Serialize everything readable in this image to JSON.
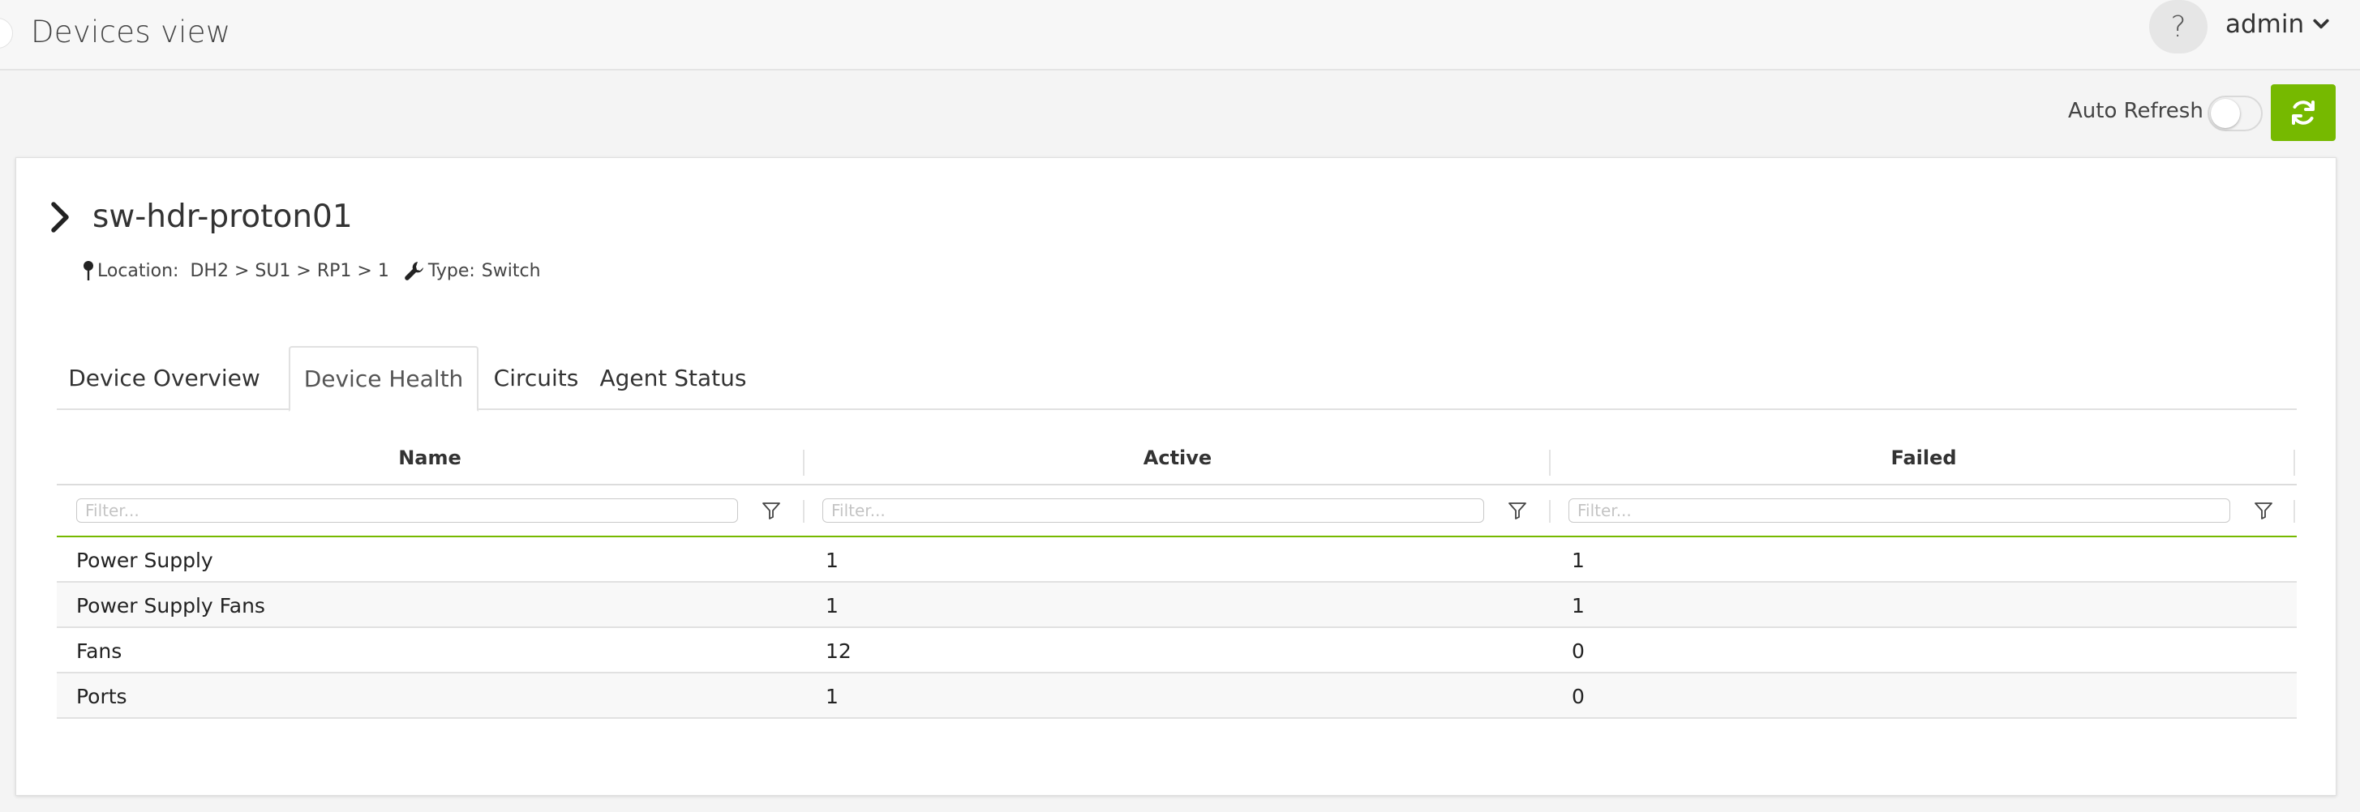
{
  "header": {
    "title": "Devices view",
    "help_label": "?",
    "user": "admin"
  },
  "toolbar": {
    "auto_refresh_label": "Auto Refresh",
    "auto_refresh_on": false
  },
  "device": {
    "name": "sw-hdr-proton01",
    "location_label": "Location:",
    "location_value": "DH2 > SU1 > RP1 > 1",
    "type_label": "Type:",
    "type_value": "Switch"
  },
  "tabs": [
    {
      "label": "Device Overview",
      "active": false
    },
    {
      "label": "Device Health",
      "active": true
    },
    {
      "label": "Circuits",
      "active": false
    },
    {
      "label": "Agent Status",
      "active": false
    }
  ],
  "table": {
    "columns": [
      "Name",
      "Active",
      "Failed"
    ],
    "filter_placeholder": "Filter...",
    "rows": [
      [
        "Power Supply",
        "1",
        "1"
      ],
      [
        "Power Supply Fans",
        "1",
        "1"
      ],
      [
        "Fans",
        "12",
        "0"
      ],
      [
        "Ports",
        "1",
        "0"
      ]
    ]
  },
  "colors": {
    "accent": "#76b900",
    "background": "#f4f4f4",
    "card": "#ffffff"
  },
  "icons": {
    "refresh": "refresh-icon",
    "expand": "chevron-right-icon",
    "location": "map-pin-icon",
    "type": "wrench-icon",
    "filter": "filter-icon",
    "user_menu": "chevron-down-icon"
  }
}
